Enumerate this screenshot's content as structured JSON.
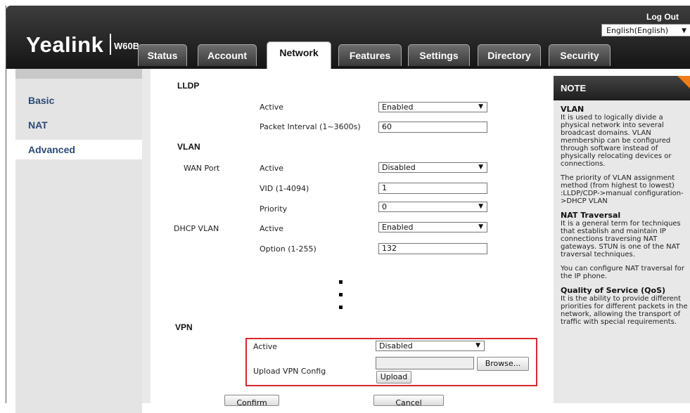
{
  "header": {
    "logo": "Yealink",
    "model": "W60B",
    "logout": "Log Out",
    "language": "English(English)"
  },
  "tabs": [
    {
      "label": "Status"
    },
    {
      "label": "Account"
    },
    {
      "label": "Network"
    },
    {
      "label": "Features"
    },
    {
      "label": "Settings"
    },
    {
      "label": "Directory"
    },
    {
      "label": "Security"
    }
  ],
  "sidebar": {
    "items": [
      {
        "label": "Basic"
      },
      {
        "label": "NAT"
      },
      {
        "label": "Advanced"
      }
    ]
  },
  "main": {
    "lldp": {
      "title": "LLDP",
      "active_label": "Active",
      "active_value": "Enabled",
      "interval_label": "Packet Interval (1~3600s)",
      "interval_value": "60"
    },
    "vlan": {
      "title": "VLAN",
      "wan_port": "WAN Port",
      "wan_active_label": "Active",
      "wan_active_value": "Disabled",
      "vid_label": "VID (1-4094)",
      "vid_value": "1",
      "priority_label": "Priority",
      "priority_value": "0",
      "dhcp_vlan": "DHCP VLAN",
      "dhcp_active_label": "Active",
      "dhcp_active_value": "Enabled",
      "option_label": "Option (1-255)",
      "option_value": "132"
    },
    "vpn": {
      "title": "VPN",
      "active_label": "Active",
      "active_value": "Disabled",
      "upload_label": "Upload VPN Config",
      "file_value": "",
      "browse": "Browse...",
      "upload": "Upload"
    },
    "confirm": "Confirm",
    "cancel": "Cancel"
  },
  "note": {
    "title": "NOTE",
    "vlan_title": "VLAN",
    "vlan_text": "It is used to logically divide a physical network into several broadcast domains. VLAN membership can be configured through software instead of physically relocating devices or connections.",
    "vlan_priority": "The priority of VLAN assignment method (from highest to lowest) :LLDP/CDP->manual configuration->DHCP VLAN",
    "nat_title": "NAT Traversal",
    "nat_text": "It is a general term for techniques that establish and maintain IP connections traversing NAT gateways. STUN is one of the NAT traversal techniques.",
    "nat_config": "You can configure NAT traversal for the IP phone.",
    "qos_title": "Quality of Service (QoS)",
    "qos_text": "It is the ability to provide different priorities for different packets in the network, allowing the transport of traffic with special requirements."
  },
  "colors": {
    "header_bg": "#1e1e1e",
    "sidebar_link": "#2b4a77",
    "highlight_box": "#d8262e",
    "note_corner": "#f07d1a"
  }
}
